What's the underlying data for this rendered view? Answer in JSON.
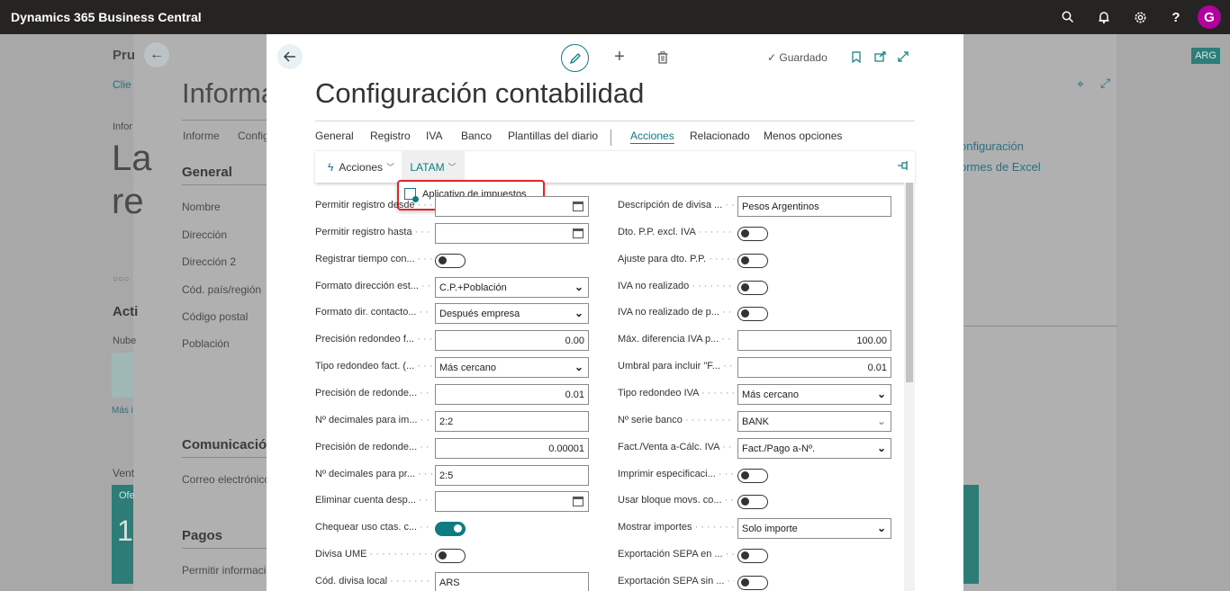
{
  "app": {
    "title": "Dynamics 365 Business Central",
    "avatar_letter": "G"
  },
  "topbar_icons": [
    "search-icon",
    "bell-icon",
    "gear-icon",
    "help-icon"
  ],
  "background": {
    "title_fragment": "Pru",
    "link_fragment": "Clie",
    "big_title_fragment": "Informa",
    "tab_informe": "Informe",
    "tab_config": "Config",
    "infor_fragment": "Infor",
    "la_fragment": "La",
    "re_fragment": "re",
    "general_header": "General",
    "labels": [
      "Nombre",
      "Dirección",
      "Dirección 2",
      "Cód. país/región",
      "Código postal",
      "Población"
    ],
    "acti_fragment": "Acti",
    "nube_fragment": "Nube",
    "mas_fragment": "Más i",
    "comunicacion_header": "Comunicación",
    "correo_label": "Correo electrónico",
    "pagos_header": "Pagos",
    "permitir_label": "Permitir información",
    "vent_fragment": "Vent",
    "ofe_fragment": "Ofe",
    "one_fragment": "1",
    "arg_badge": "ARG",
    "right_links": [
      "onfiguración",
      "ormes de Excel"
    ]
  },
  "modal": {
    "title": "Configuración contabilidad",
    "saved_label": "Guardado",
    "tabs": [
      "General",
      "Registro",
      "IVA",
      "Banco",
      "Plantillas del diario",
      "Acciones",
      "Relacionado",
      "Menos opciones"
    ],
    "active_tab": "Acciones",
    "actions_label": "Acciones",
    "latam_label": "LATAM",
    "dropdown_item": "Aplicativo de impuestos"
  },
  "left_fields": [
    {
      "label": "Permitir registro desde",
      "kind": "date",
      "value": ""
    },
    {
      "label": "Permitir registro hasta",
      "kind": "date",
      "value": ""
    },
    {
      "label": "Registrar tiempo con...",
      "kind": "toggle",
      "value": "off"
    },
    {
      "label": "Formato dirección est...",
      "kind": "select",
      "value": "C.P.+Población"
    },
    {
      "label": "Formato dir. contacto...",
      "kind": "select",
      "value": "Después empresa"
    },
    {
      "label": "Precisión redondeo f...",
      "kind": "number",
      "value": "0.00"
    },
    {
      "label": "Tipo redondeo fact. (...",
      "kind": "select",
      "value": "Más cercano"
    },
    {
      "label": "Precisión de redonde...",
      "kind": "number",
      "value": "0.01"
    },
    {
      "label": "Nº decimales para im...",
      "kind": "text",
      "value": "2:2"
    },
    {
      "label": "Precisión de redonde...",
      "kind": "number",
      "value": "0.00001"
    },
    {
      "label": "Nº decimales para pr...",
      "kind": "text",
      "value": "2:5"
    },
    {
      "label": "Eliminar cuenta desp...",
      "kind": "date",
      "value": ""
    },
    {
      "label": "Chequear uso ctas. c...",
      "kind": "toggle",
      "value": "on"
    },
    {
      "label": "Divisa UME",
      "kind": "toggle",
      "value": "off"
    },
    {
      "label": "Cód. divisa local",
      "kind": "text",
      "value": "ARS"
    }
  ],
  "right_fields": [
    {
      "label": "Descripción de divisa ...",
      "kind": "text",
      "value": "Pesos Argentinos"
    },
    {
      "label": "Dto. P.P. excl. IVA",
      "kind": "toggle",
      "value": "off"
    },
    {
      "label": "Ajuste para dto. P.P.",
      "kind": "toggle",
      "value": "off"
    },
    {
      "label": "IVA no realizado",
      "kind": "toggle",
      "value": "off"
    },
    {
      "label": "IVA no realizado de p...",
      "kind": "toggle",
      "value": "off"
    },
    {
      "label": "Máx. diferencia IVA p...",
      "kind": "number",
      "value": "100.00"
    },
    {
      "label": "Umbral para incluir \"F...",
      "kind": "number",
      "value": "0.01"
    },
    {
      "label": "Tipo redondeo IVA",
      "kind": "select",
      "value": "Más cercano"
    },
    {
      "label": "Nº serie banco",
      "kind": "select-light",
      "value": "BANK"
    },
    {
      "label": "Fact./Venta a-Cálc. IVA",
      "kind": "select",
      "value": "Fact./Pago a-Nº."
    },
    {
      "label": "Imprimir especificaci...",
      "kind": "toggle",
      "value": "off"
    },
    {
      "label": "Usar bloque movs. co...",
      "kind": "toggle",
      "value": "off"
    },
    {
      "label": "Mostrar importes",
      "kind": "select",
      "value": "Solo importe"
    },
    {
      "label": "Exportación SEPA en ...",
      "kind": "toggle",
      "value": "off"
    },
    {
      "label": "Exportación SEPA sin ...",
      "kind": "toggle",
      "value": "off"
    }
  ]
}
